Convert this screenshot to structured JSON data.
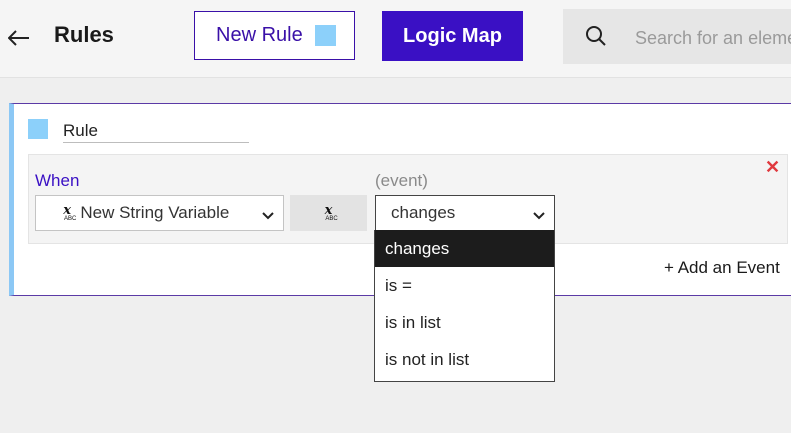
{
  "header": {
    "title": "Rules",
    "new_rule_label": "New Rule",
    "new_rule_swatch_color": "#8cd0fa",
    "logic_map_label": "Logic Map",
    "search_placeholder": "Search for an element"
  },
  "rule": {
    "name": "Rule",
    "color": "#8cd0fa",
    "condition": {
      "when_label": "When",
      "event_label": "(event)",
      "variable": "New String Variable",
      "variable_icon": "string-variable-icon",
      "event_value": "changes"
    },
    "add_event_label": "+ Add an Event"
  },
  "event_dropdown": {
    "options": [
      "changes",
      "is =",
      "is in list",
      "is not in list"
    ],
    "selected": "changes"
  },
  "colors": {
    "brand": "#3a10c4",
    "delete": "#e0393e"
  }
}
